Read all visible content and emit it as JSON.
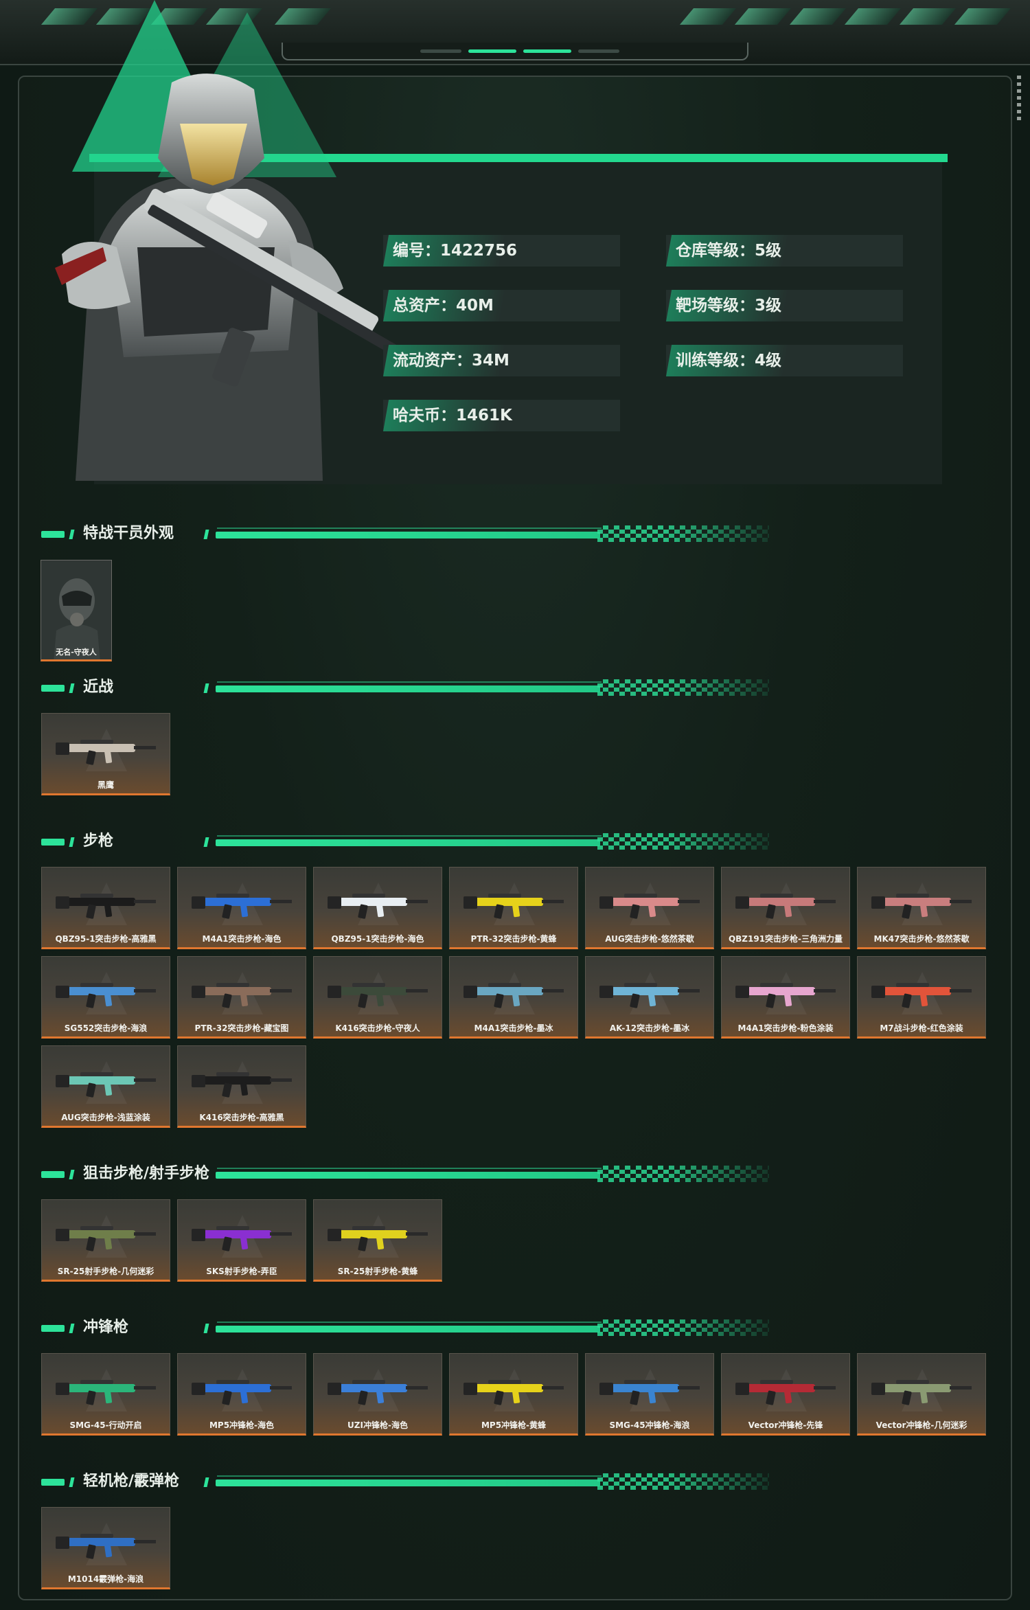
{
  "stats": {
    "id": "编号：1422756",
    "total_assets": "总资产：40M",
    "liquid_assets": "流动资产：34M",
    "hafu_coin": "哈夫币：1461K",
    "warehouse_level": "仓库等级：5级",
    "range_level": "靶场等级：3级",
    "training_level": "训练等级：4级"
  },
  "sections": {
    "agent": "特战干员外观",
    "melee": "近战",
    "rifle": "步枪",
    "sniper": "狙击步枪/射手步枪",
    "smg": "冲锋枪",
    "lmg": "轻机枪/霰弹枪"
  },
  "agent_skins": [
    "无名-守夜人"
  ],
  "melee_items": [
    "黑鹰"
  ],
  "rifles": [
    "QBZ95-1突击步枪-高雅黑",
    "M4A1突击步枪-海色",
    "QBZ95-1突击步枪-海色",
    "PTR-32突击步枪-黄蜂",
    "AUG突击步枪-悠然茶歇",
    "QBZ191突击步枪-三角洲力量",
    "MK47突击步枪-悠然茶歇",
    "SG552突击步枪-海浪",
    "PTR-32突击步枪-藏宝图",
    "K416突击步枪-守夜人",
    "M4A1突击步枪-墨冰",
    "AK-12突击步枪-墨冰",
    "M4A1突击步枪-粉色涂装",
    "M7战斗步枪-红色涂装",
    "AUG突击步枪-浅蓝涂装",
    "K416突击步枪-高雅黑"
  ],
  "snipers": [
    "SR-25射手步枪-几何迷彩",
    "SKS射手步枪-弄臣",
    "SR-25射手步枪-黄蜂"
  ],
  "smgs": [
    "SMG-45-行动开启",
    "MP5冲锋枪-海色",
    "UZI冲锋枪-海色",
    "MP5冲锋枪-黄蜂",
    "SMG-45冲锋枪-海浪",
    "Vector冲锋枪-先锋",
    "Vector冲锋枪-几何迷彩"
  ],
  "lmgs": [
    "M1014霰弹枪-海浪"
  ],
  "colors": {
    "accent": "#2de39a",
    "card_border": "#e0772f",
    "bg": "#0f1a15"
  }
}
